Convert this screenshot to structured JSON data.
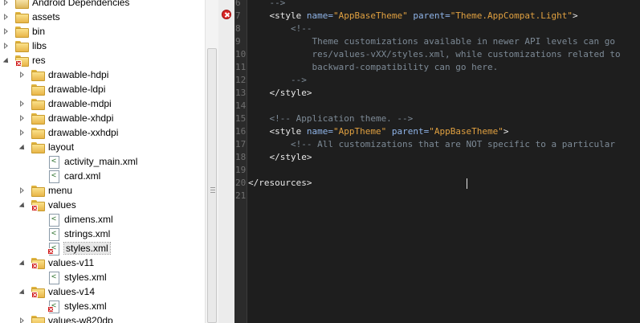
{
  "explorer": {
    "items": [
      {
        "label": "Android Dependencies",
        "indent": 0,
        "toggle": "collapsed",
        "icon": "library-icon",
        "error": false
      },
      {
        "label": "assets",
        "indent": 0,
        "toggle": "collapsed",
        "icon": "folder-icon",
        "error": false
      },
      {
        "label": "bin",
        "indent": 0,
        "toggle": "collapsed",
        "icon": "folder-icon",
        "error": false
      },
      {
        "label": "libs",
        "indent": 0,
        "toggle": "collapsed",
        "icon": "folder-icon",
        "error": false
      },
      {
        "label": "res",
        "indent": 0,
        "toggle": "expanded",
        "icon": "folder-icon",
        "error": true
      },
      {
        "label": "drawable-hdpi",
        "indent": 1,
        "toggle": "collapsed",
        "icon": "folder-icon",
        "error": false
      },
      {
        "label": "drawable-ldpi",
        "indent": 1,
        "toggle": "none",
        "icon": "folder-icon",
        "error": false
      },
      {
        "label": "drawable-mdpi",
        "indent": 1,
        "toggle": "collapsed",
        "icon": "folder-icon",
        "error": false
      },
      {
        "label": "drawable-xhdpi",
        "indent": 1,
        "toggle": "collapsed",
        "icon": "folder-icon",
        "error": false
      },
      {
        "label": "drawable-xxhdpi",
        "indent": 1,
        "toggle": "collapsed",
        "icon": "folder-icon",
        "error": false
      },
      {
        "label": "layout",
        "indent": 1,
        "toggle": "expanded",
        "icon": "folder-icon",
        "error": false
      },
      {
        "label": "activity_main.xml",
        "indent": 2,
        "toggle": "none",
        "icon": "xml-file-icon",
        "error": false
      },
      {
        "label": "card.xml",
        "indent": 2,
        "toggle": "none",
        "icon": "xml-file-icon",
        "error": false
      },
      {
        "label": "menu",
        "indent": 1,
        "toggle": "collapsed",
        "icon": "folder-icon",
        "error": false
      },
      {
        "label": "values",
        "indent": 1,
        "toggle": "expanded",
        "icon": "folder-icon",
        "error": true
      },
      {
        "label": "dimens.xml",
        "indent": 2,
        "toggle": "none",
        "icon": "xml-file-icon",
        "error": false
      },
      {
        "label": "strings.xml",
        "indent": 2,
        "toggle": "none",
        "icon": "xml-file-icon",
        "error": false
      },
      {
        "label": "styles.xml",
        "indent": 2,
        "toggle": "none",
        "icon": "xml-file-icon",
        "error": true,
        "selected": true
      },
      {
        "label": "values-v11",
        "indent": 1,
        "toggle": "expanded",
        "icon": "folder-icon",
        "error": true
      },
      {
        "label": "styles.xml",
        "indent": 2,
        "toggle": "none",
        "icon": "xml-file-icon",
        "error": false
      },
      {
        "label": "values-v14",
        "indent": 1,
        "toggle": "expanded",
        "icon": "folder-icon",
        "error": true
      },
      {
        "label": "styles.xml",
        "indent": 2,
        "toggle": "none",
        "icon": "xml-file-icon",
        "error": true
      },
      {
        "label": "values-w820dp",
        "indent": 1,
        "toggle": "collapsed",
        "icon": "folder-icon",
        "error": false
      }
    ]
  },
  "editor": {
    "error_line": "7",
    "lines": [
      {
        "num": "6",
        "parts": [
          {
            "t": "    -->",
            "c": "cmt"
          }
        ]
      },
      {
        "num": "7",
        "parts": [
          {
            "t": "    <style ",
            "c": "tag"
          },
          {
            "t": "name=",
            "c": "attr"
          },
          {
            "t": "\"AppBaseTheme\"",
            "c": "val"
          },
          {
            "t": " ",
            "c": "tag"
          },
          {
            "t": "parent=",
            "c": "attr"
          },
          {
            "t": "\"Theme.AppCompat.Light\"",
            "c": "val"
          },
          {
            "t": ">",
            "c": "tag"
          }
        ]
      },
      {
        "num": "8",
        "parts": [
          {
            "t": "        <!--",
            "c": "cmt"
          }
        ]
      },
      {
        "num": "9",
        "parts": [
          {
            "t": "            Theme customizations available in newer API levels can go",
            "c": "cmt"
          }
        ]
      },
      {
        "num": "10",
        "parts": [
          {
            "t": "            res/values-vXX/styles.xml, while customizations related to",
            "c": "cmt"
          }
        ]
      },
      {
        "num": "11",
        "parts": [
          {
            "t": "            backward-compatibility can go here.",
            "c": "cmt"
          }
        ]
      },
      {
        "num": "12",
        "parts": [
          {
            "t": "        -->",
            "c": "cmt"
          }
        ]
      },
      {
        "num": "13",
        "parts": [
          {
            "t": "    </style>",
            "c": "tag"
          }
        ]
      },
      {
        "num": "14",
        "parts": [
          {
            "t": "",
            "c": "tag"
          }
        ]
      },
      {
        "num": "15",
        "parts": [
          {
            "t": "    <!-- Application theme. -->",
            "c": "cmt"
          }
        ]
      },
      {
        "num": "16",
        "parts": [
          {
            "t": "    <style ",
            "c": "tag"
          },
          {
            "t": "name=",
            "c": "attr"
          },
          {
            "t": "\"AppTheme\"",
            "c": "val"
          },
          {
            "t": " ",
            "c": "tag"
          },
          {
            "t": "parent=",
            "c": "attr"
          },
          {
            "t": "\"AppBaseTheme\"",
            "c": "val"
          },
          {
            "t": ">",
            "c": "tag"
          }
        ]
      },
      {
        "num": "17",
        "parts": [
          {
            "t": "        <!-- All customizations that are NOT specific to a particular",
            "c": "cmt"
          }
        ]
      },
      {
        "num": "18",
        "parts": [
          {
            "t": "    </style>",
            "c": "tag"
          }
        ]
      },
      {
        "num": "19",
        "parts": [
          {
            "t": "",
            "c": "tag"
          }
        ]
      },
      {
        "num": "20",
        "parts": [
          {
            "t": "</resources>",
            "c": "tag"
          }
        ]
      },
      {
        "num": "21",
        "parts": [
          {
            "t": "",
            "c": "tag"
          }
        ]
      }
    ]
  },
  "colors": {
    "editor_bg": "#1e1e1e",
    "tag": "#e8e8e8",
    "attribute": "#8fb4e8",
    "value": "#e0a040",
    "comment": "#7d8a96",
    "error": "#d92626"
  }
}
